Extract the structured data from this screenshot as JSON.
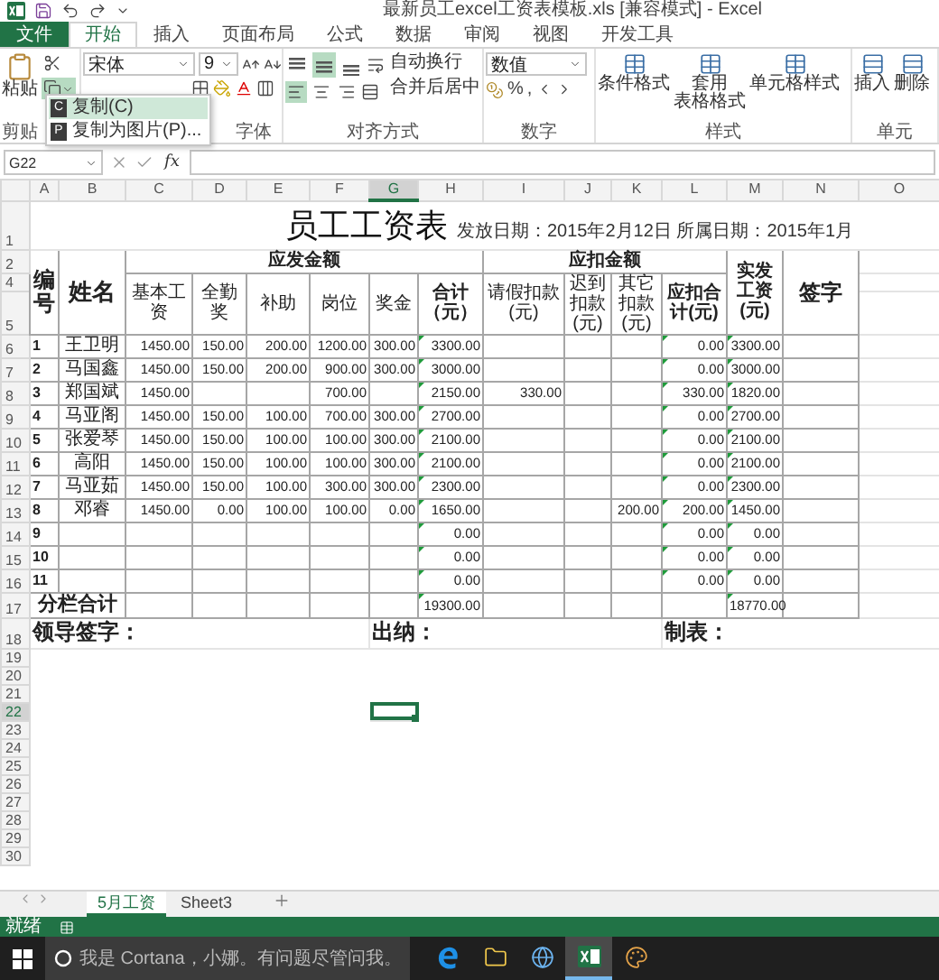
{
  "window": {
    "title": "最新员工excel工资表模板.xls  [兼容模式] - Excel"
  },
  "tabs": [
    {
      "label": "文件",
      "kind": "file",
      "selected": false
    },
    {
      "label": "开始",
      "kind": "tab",
      "selected": true
    },
    {
      "label": "插入",
      "kind": "tab",
      "selected": false
    },
    {
      "label": "页面布局",
      "kind": "tab",
      "selected": false
    },
    {
      "label": "公式",
      "kind": "tab",
      "selected": false
    },
    {
      "label": "数据",
      "kind": "tab",
      "selected": false
    },
    {
      "label": "审阅",
      "kind": "tab",
      "selected": false
    },
    {
      "label": "视图",
      "kind": "tab",
      "selected": false
    },
    {
      "label": "开发工具",
      "kind": "tab",
      "selected": false
    }
  ],
  "ribbon": {
    "clipboard": {
      "paste": "粘贴",
      "label": "剪贴"
    },
    "font": {
      "name": "宋体",
      "size": "9",
      "label": "字体"
    },
    "alignment": {
      "valign": [
        {
          "selected": false
        },
        {
          "selected": true
        },
        {
          "selected": false
        }
      ],
      "halign": [
        {
          "selected": true
        },
        {
          "selected": false
        },
        {
          "selected": false
        }
      ],
      "wrap": "自动换行",
      "merge": "合并后居中",
      "label": "对齐方式"
    },
    "number": {
      "format": "数值",
      "percent": "%",
      "comma": ",",
      "label": "数字"
    },
    "styles": {
      "buttons": [
        [
          "条件格式"
        ],
        [
          "套用",
          "表格格式"
        ],
        [
          "单元格样式"
        ]
      ],
      "label": "样式"
    },
    "cells": {
      "buttons": [
        "插入",
        "删除"
      ],
      "label": "单元"
    }
  },
  "copy_menu": {
    "items": [
      {
        "label": "复制(C)",
        "key": "C",
        "selected": true
      },
      {
        "label": "复制为图片(P)...",
        "key": "P",
        "selected": false
      }
    ]
  },
  "formula_bar": {
    "name_box": "G22",
    "function_button": "fx"
  },
  "columns": [
    {
      "letter": "A",
      "selected": false,
      "flagged": false
    },
    {
      "letter": "B",
      "selected": false,
      "flagged": false
    },
    {
      "letter": "C",
      "selected": false,
      "flagged": false
    },
    {
      "letter": "D",
      "selected": false,
      "flagged": false
    },
    {
      "letter": "E",
      "selected": false,
      "flagged": false
    },
    {
      "letter": "F",
      "selected": false,
      "flagged": false
    },
    {
      "letter": "G",
      "selected": true,
      "flagged": false
    },
    {
      "letter": "H",
      "selected": false,
      "flagged": true
    },
    {
      "letter": "I",
      "selected": false,
      "flagged": false
    },
    {
      "letter": "J",
      "selected": false,
      "flagged": false
    },
    {
      "letter": "K",
      "selected": false,
      "flagged": false
    },
    {
      "letter": "L",
      "selected": false,
      "flagged": true
    },
    {
      "letter": "M",
      "selected": false,
      "flagged": true
    },
    {
      "letter": "N",
      "selected": false,
      "flagged": false
    },
    {
      "letter": "O",
      "selected": false,
      "flagged": false
    }
  ],
  "sheet": {
    "title_row": "1",
    "title": "员工工资表",
    "date_text": "发放日期：2015年2月12日 所属日期：2015年1月",
    "header_rows": [
      "2",
      "4",
      "5"
    ],
    "id_header": "编号",
    "name_header": "姓名",
    "payable_group": "应发金额",
    "payable_columns": [
      "基本工资",
      "全勤奖",
      "补助",
      "岗位",
      "奖金",
      "合计（元）"
    ],
    "deduct_group": "应扣金额",
    "deduct_columns": [
      "请假扣款(元)",
      "迟到扣款(元)",
      "其它扣款(元)",
      "应扣合计(元)"
    ],
    "net_header": "实发工资(元)",
    "sign_header": "签字",
    "rows": [
      {
        "row": "6",
        "no": "1",
        "name": "王卫明",
        "values": {
          "C": "1450.00",
          "D": "150.00",
          "E": "200.00",
          "F": "1200.00",
          "G": "300.00",
          "H": "3300.00",
          "L": "0.00",
          "M": "3300.00"
        }
      },
      {
        "row": "7",
        "no": "2",
        "name": "马国鑫",
        "values": {
          "C": "1450.00",
          "D": "150.00",
          "E": "200.00",
          "F": "900.00",
          "G": "300.00",
          "H": "3000.00",
          "L": "0.00",
          "M": "3000.00"
        }
      },
      {
        "row": "8",
        "no": "3",
        "name": "郑国斌",
        "values": {
          "C": "1450.00",
          "F": "700.00",
          "H": "2150.00",
          "I": "330.00",
          "L": "330.00",
          "M": "1820.00"
        }
      },
      {
        "row": "9",
        "no": "4",
        "name": "马亚阁",
        "values": {
          "C": "1450.00",
          "D": "150.00",
          "E": "100.00",
          "F": "700.00",
          "G": "300.00",
          "H": "2700.00",
          "L": "0.00",
          "M": "2700.00"
        }
      },
      {
        "row": "10",
        "no": "5",
        "name": "张爱琴",
        "values": {
          "C": "1450.00",
          "D": "150.00",
          "E": "100.00",
          "F": "100.00",
          "G": "300.00",
          "H": "2100.00",
          "L": "0.00",
          "M": "2100.00"
        }
      },
      {
        "row": "11",
        "no": "6",
        "name": "高阳",
        "values": {
          "C": "1450.00",
          "D": "150.00",
          "E": "100.00",
          "F": "100.00",
          "G": "300.00",
          "H": "2100.00",
          "L": "0.00",
          "M": "2100.00"
        }
      },
      {
        "row": "12",
        "no": "7",
        "name": "马亚茹",
        "values": {
          "C": "1450.00",
          "D": "150.00",
          "E": "100.00",
          "F": "300.00",
          "G": "300.00",
          "H": "2300.00",
          "L": "0.00",
          "M": "2300.00"
        }
      },
      {
        "row": "13",
        "no": "8",
        "name": "邓睿",
        "values": {
          "C": "1450.00",
          "D": "0.00",
          "E": "100.00",
          "F": "100.00",
          "G": "0.00",
          "H": "1650.00",
          "K": "200.00",
          "L": "200.00",
          "M": "1450.00"
        }
      },
      {
        "row": "14",
        "no": "9",
        "values": {
          "H": "0.00",
          "L": "0.00",
          "M": "0.00"
        }
      },
      {
        "row": "15",
        "no": "10",
        "values": {
          "H": "0.00",
          "L": "0.00",
          "M": "0.00"
        }
      },
      {
        "row": "16",
        "no": "11",
        "values": {
          "H": "0.00",
          "L": "0.00",
          "M": "0.00"
        }
      }
    ],
    "total": {
      "row": "17",
      "label": "分栏合计",
      "values": {
        "H": "19300.00",
        "M": "18770.00"
      }
    },
    "signatures": {
      "row": "18",
      "leader": "领导签字：",
      "cashier": "出纳：",
      "maker": "制表："
    },
    "empty_rows": [
      {
        "number": "19",
        "selected": false
      },
      {
        "number": "20",
        "selected": false
      },
      {
        "number": "21",
        "selected": false
      },
      {
        "number": "22",
        "selected": true
      },
      {
        "number": "23",
        "selected": false
      },
      {
        "number": "24",
        "selected": false
      },
      {
        "number": "25",
        "selected": false
      },
      {
        "number": "26",
        "selected": false
      },
      {
        "number": "27",
        "selected": false
      },
      {
        "number": "28",
        "selected": false
      },
      {
        "number": "29",
        "selected": false
      },
      {
        "number": "30",
        "selected": false
      }
    ]
  },
  "sheet_tabs": [
    {
      "label": "5月工资",
      "selected": true
    },
    {
      "label": "Sheet3",
      "selected": false
    }
  ],
  "status_bar": {
    "text": "就绪"
  },
  "taskbar": {
    "search_placeholder": "我是 Cortana，小娜。有问题尽管问我。",
    "apps": [
      {
        "kind": "edge",
        "active": false
      },
      {
        "kind": "folder",
        "active": false
      },
      {
        "kind": "globe",
        "active": false
      },
      {
        "kind": "excel",
        "active": true
      },
      {
        "kind": "paint",
        "active": false
      }
    ]
  }
}
